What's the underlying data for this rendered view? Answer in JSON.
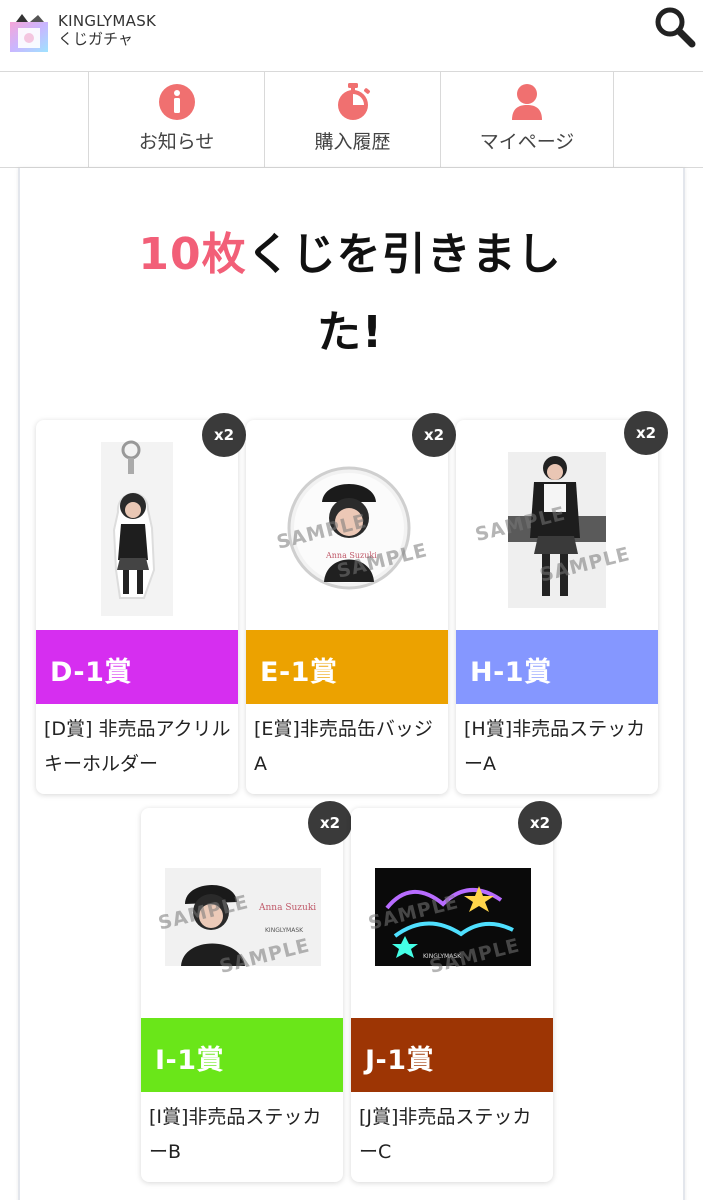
{
  "header": {
    "brand_name": "KINGLYMASK",
    "brand_sub": "くじガチャ",
    "logo_icon": "kinglymask-logo-icon",
    "search_icon": "search-icon"
  },
  "nav": {
    "items": [
      {
        "label": "お知らせ",
        "icon": "info-icon",
        "color": "#f07070"
      },
      {
        "label": "購入履歴",
        "icon": "stopwatch-icon",
        "color": "#f07070"
      },
      {
        "label": "マイページ",
        "icon": "user-icon",
        "color": "#f07070"
      }
    ]
  },
  "result": {
    "count": "10枚",
    "line1": "くじを引きまし",
    "line2": "た!",
    "count_color": "#f25f78"
  },
  "prizes": [
    {
      "rank": "D-1賞",
      "name": "[D賞] 非売品アクリルキーホルダー",
      "qty": "x2",
      "band_color": "#d62ef0",
      "image": "acrylic-keyholder"
    },
    {
      "rank": "E-1賞",
      "name": "[E賞]非売品缶バッジA",
      "qty": "x2",
      "band_color": "#eca200",
      "image": "can-badge",
      "watermark": "SAMPLE"
    },
    {
      "rank": "H-1賞",
      "name": "[H賞]非売品ステッカーA",
      "qty": "x2",
      "band_color": "#8597ff",
      "image": "sticker-a",
      "watermark": "SAMPLE"
    },
    {
      "rank": "I-1賞",
      "name": "[I賞]非売品ステッカーB",
      "qty": "x2",
      "band_color": "#6ae619",
      "image": "sticker-b",
      "watermark": "SAMPLE"
    },
    {
      "rank": "J-1賞",
      "name": "[J賞]非売品ステッカーC",
      "qty": "x2",
      "band_color": "#9d3504",
      "image": "sticker-c",
      "watermark": "SAMPLE"
    }
  ]
}
